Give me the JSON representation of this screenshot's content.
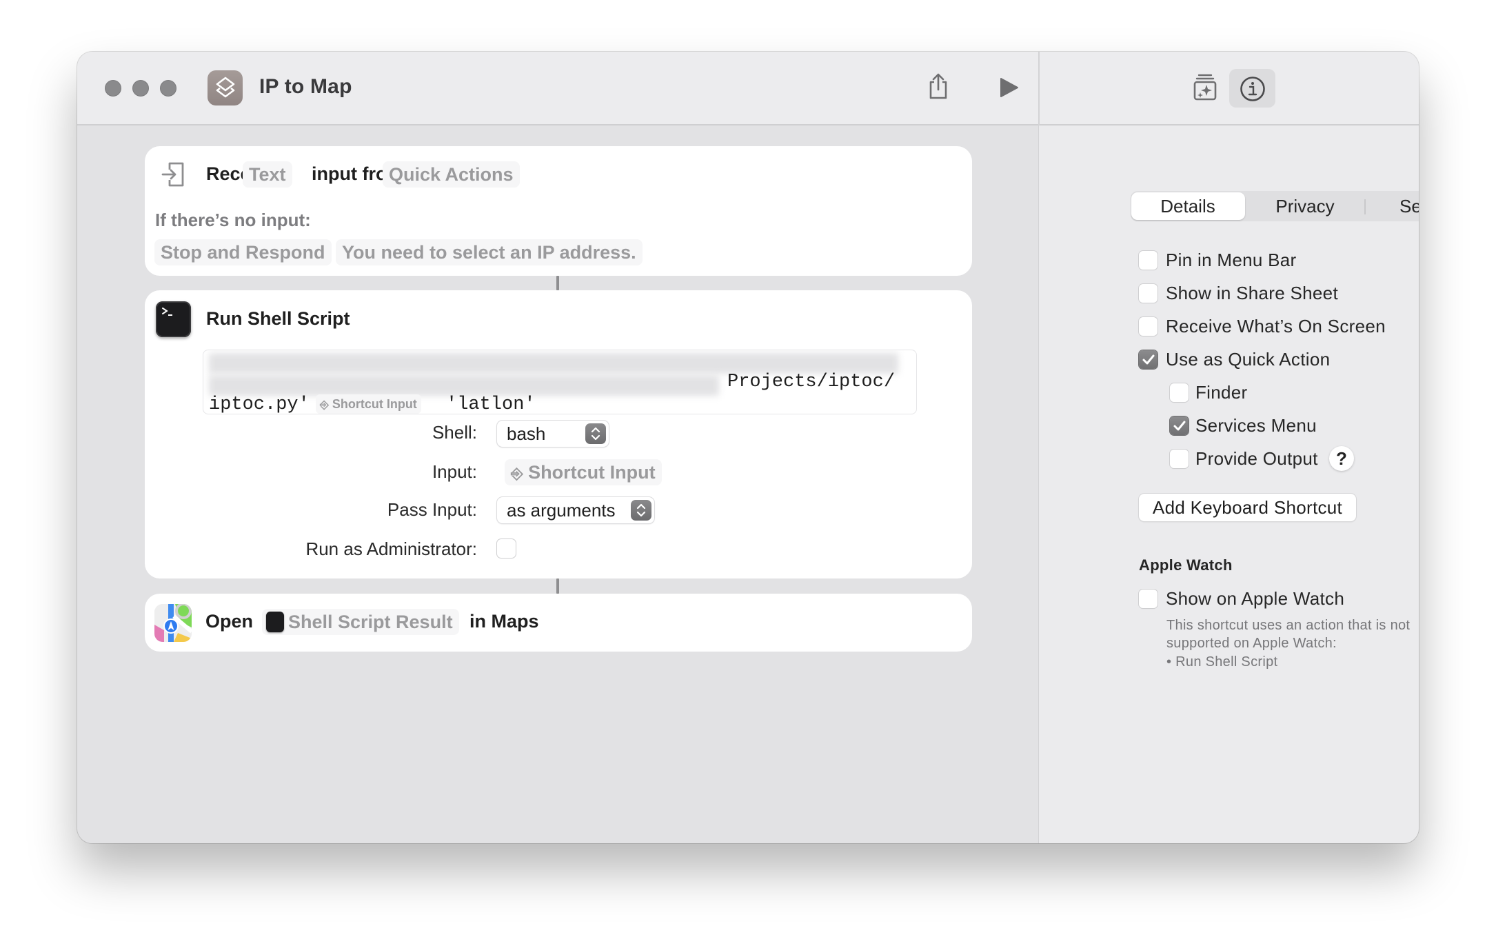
{
  "window": {
    "title": "IP to Map",
    "app_icon": "shortcuts-icon",
    "toolbar": {
      "share_icon": "share-icon",
      "run_icon": "play-icon",
      "gallery_icon": "action-library-icon",
      "info_icon": "info-icon"
    }
  },
  "editor": {
    "receive_action": {
      "icon": "receive-input-icon",
      "word_receive": "Receive",
      "type_token": "Text",
      "word_input_from": "input from",
      "source_token": "Quick Actions",
      "no_input_label": "If there’s no input:",
      "no_input_action": "Stop and Respond",
      "no_input_message": "You need to select an IP address."
    },
    "shell_action": {
      "icon": "terminal-icon",
      "title": "Run Shell Script",
      "script_line2_visible": "Projects/iptoc/",
      "script_line3_prefix": "iptoc.py'",
      "script_variable": "Shortcut Input",
      "script_line3_suffix": "'latlon'",
      "shell_label": "Shell:",
      "shell_value": "bash",
      "input_label": "Input:",
      "input_value": "Shortcut Input",
      "pass_input_label": "Pass Input:",
      "pass_input_value": "as arguments",
      "run_as_admin_label": "Run as Administrator:",
      "run_as_admin_checked": false
    },
    "maps_action": {
      "icon": "maps-icon",
      "word_open": "Open",
      "variable": "Shell Script Result",
      "word_in_maps": "in Maps"
    }
  },
  "sidebar": {
    "tabs": [
      {
        "label": "Details",
        "selected": true
      },
      {
        "label": "Privacy",
        "selected": false
      },
      {
        "label": "Setup",
        "selected": false
      }
    ],
    "options": [
      {
        "label": "Pin in Menu Bar",
        "checked": false
      },
      {
        "label": "Show in Share Sheet",
        "checked": false
      },
      {
        "label": "Receive What’s On Screen",
        "checked": false
      },
      {
        "label": "Use as Quick Action",
        "checked": true
      }
    ],
    "quick_action_options": [
      {
        "label": "Finder",
        "checked": false
      },
      {
        "label": "Services Menu",
        "checked": true
      },
      {
        "label": "Provide Output",
        "checked": false
      }
    ],
    "help_label": "?",
    "add_shortcut_button": "Add Keyboard Shortcut",
    "apple_watch": {
      "heading": "Apple Watch",
      "option_label": "Show on Apple Watch",
      "option_checked": false,
      "note_line1": "This shortcut uses an action that is not",
      "note_line2": "supported on Apple Watch:",
      "note_line3": "• Run Shell Script"
    }
  }
}
